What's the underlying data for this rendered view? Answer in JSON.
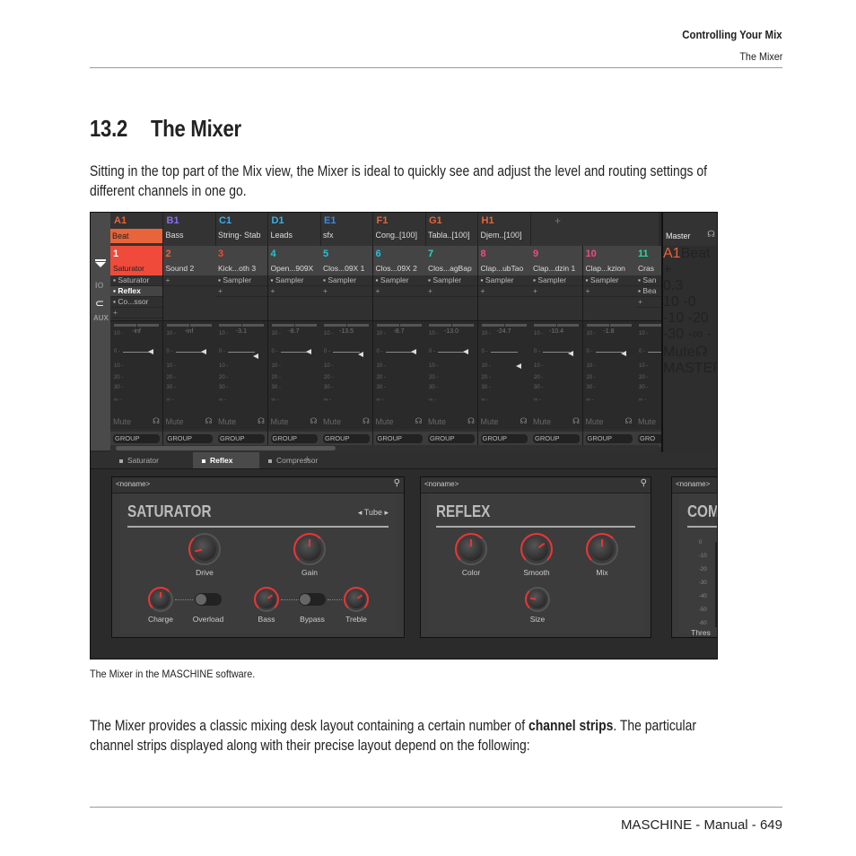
{
  "header": {
    "chapter": "Controlling Your Mix",
    "section": "The Mixer"
  },
  "section": {
    "number": "13.2",
    "title": "The Mixer"
  },
  "intro": "Sitting in the top part of the Mix view, the Mixer is ideal to quickly see and adjust the level and routing settings of different channels in one go.",
  "caption": "The Mixer in the MASCHINE software.",
  "body": {
    "pre": "The Mixer provides a classic mixing desk layout containing a certain number of ",
    "bold": "channel strips",
    "post": ". The particular channel strips displayed along with their precise layout depend on the following:"
  },
  "footer": "MASCHINE - Manual - 649",
  "mixer": {
    "side": {
      "io": "IO",
      "aux": "AUX"
    },
    "accent": "#e8643a",
    "groups": [
      {
        "letter": "A1",
        "name": "Beat",
        "color": "#e8643a",
        "selected": true
      },
      {
        "letter": "B1",
        "name": "Bass",
        "color": "#8a6ee8"
      },
      {
        "letter": "C1",
        "name": "String- Stab",
        "color": "#3ab0e8"
      },
      {
        "letter": "D1",
        "name": "Leads",
        "color": "#3ab0e8"
      },
      {
        "letter": "E1",
        "name": "sfx",
        "color": "#3a8ae8"
      },
      {
        "letter": "F1",
        "name": "Cong..[100]",
        "color": "#e8643a"
      },
      {
        "letter": "G1",
        "name": "Tabla..[100]",
        "color": "#e8643a"
      },
      {
        "letter": "H1",
        "name": "Djem..[100]",
        "color": "#e8643a"
      }
    ],
    "group_add": "+",
    "master": {
      "label": "Master",
      "headphone_icon": "headphones-icon"
    },
    "strips": [
      {
        "num": "1",
        "name": "Saturator",
        "color": "#ff9a8a",
        "selected": true,
        "plugins": [
          "Saturator",
          "Reflex",
          "Co...ssor"
        ],
        "highlight": 1,
        "level": "-inf",
        "fader": 0.0,
        "group": "GROUP"
      },
      {
        "num": "2",
        "name": "Sound 2",
        "color": "#e8643a",
        "plugins": [],
        "level": "-inf",
        "fader": 0.0,
        "group": "GROUP"
      },
      {
        "num": "3",
        "name": "Kick...oth 3",
        "color": "#f04a3a",
        "plugins": [
          "Sampler"
        ],
        "level": "-3.1",
        "fader": -3.1,
        "group": "GROUP"
      },
      {
        "num": "4",
        "name": "Open...909X",
        "color": "#2ac0d8",
        "plugins": [
          "Sampler"
        ],
        "level": "-8.7",
        "fader": 0.0,
        "group": "GROUP"
      },
      {
        "num": "5",
        "name": "Clos...09X 1",
        "color": "#2ac0d8",
        "plugins": [
          "Sampler"
        ],
        "level": "-13.5",
        "fader": -2.0,
        "group": "GROUP"
      },
      {
        "num": "6",
        "name": "Clos...09X 2",
        "color": "#2ac0d8",
        "plugins": [
          "Sampler"
        ],
        "level": "-8.7",
        "fader": 0.0,
        "group": "GROUP"
      },
      {
        "num": "7",
        "name": "Clos...agBap",
        "color": "#2ad8c0",
        "plugins": [
          "Sampler"
        ],
        "level": "-13.0",
        "fader": 0.0,
        "group": "GROUP"
      },
      {
        "num": "8",
        "name": "Clap...ubTao",
        "color": "#f04a8a",
        "plugins": [
          "Sampler"
        ],
        "level": "-24.7",
        "fader": -10.0,
        "group": "GROUP"
      },
      {
        "num": "9",
        "name": "Clap...dzin 1",
        "color": "#f04a8a",
        "plugins": [
          "Sampler"
        ],
        "level": "-10.4",
        "fader": -1.0,
        "group": "GROUP"
      },
      {
        "num": "10",
        "name": "Clap...kzion",
        "color": "#f04a8a",
        "plugins": [
          "Sampler"
        ],
        "level": "-1.8",
        "fader": -1.0,
        "group": "GROUP"
      },
      {
        "num": "11",
        "name": "Cras",
        "color": "#2ad8a0",
        "plugins": [
          "San",
          "Bea"
        ],
        "level": "",
        "fader": 0.0,
        "group": "GRO"
      }
    ],
    "master_strip": {
      "num": "A1",
      "name": "Beat",
      "level": "0.3",
      "fader": 0.0,
      "group": "MASTER"
    },
    "scale": [
      "10 -",
      "0 -",
      "10 -",
      "20 -",
      "30 -",
      "∞ -"
    ],
    "mute_label": "Mute",
    "tabs": [
      {
        "label": "Saturator"
      },
      {
        "label": "Reflex",
        "active": true
      },
      {
        "label": "Compressor"
      }
    ],
    "tab_add": "+",
    "panels": [
      {
        "preset_name": "<noname>",
        "title": "SATURATOR",
        "mode": "Tube",
        "knobs": [
          {
            "label": "Drive",
            "value": 0.12
          },
          {
            "label": "Gain",
            "value": 0.5
          },
          {
            "label": "Charge",
            "value": 0.5
          },
          {
            "label": "Bass",
            "value": 0.7
          },
          {
            "label": "Treble",
            "value": 0.7
          }
        ],
        "toggles": [
          {
            "label": "Overload",
            "on": false
          },
          {
            "label": "Bypass",
            "on": false
          }
        ]
      },
      {
        "preset_name": "<noname>",
        "title": "REFLEX",
        "knobs": [
          {
            "label": "Color",
            "value": 0.5
          },
          {
            "label": "Smooth",
            "value": 0.7
          },
          {
            "label": "Mix",
            "value": 0.5
          },
          {
            "label": "Size",
            "value": 0.2
          }
        ]
      },
      {
        "preset_name": "<noname>",
        "title": "COM",
        "meter_scale": [
          "0",
          "-10",
          "-20",
          "-30",
          "-40",
          "-50",
          "-60"
        ],
        "knob_label": "Thres"
      }
    ]
  }
}
